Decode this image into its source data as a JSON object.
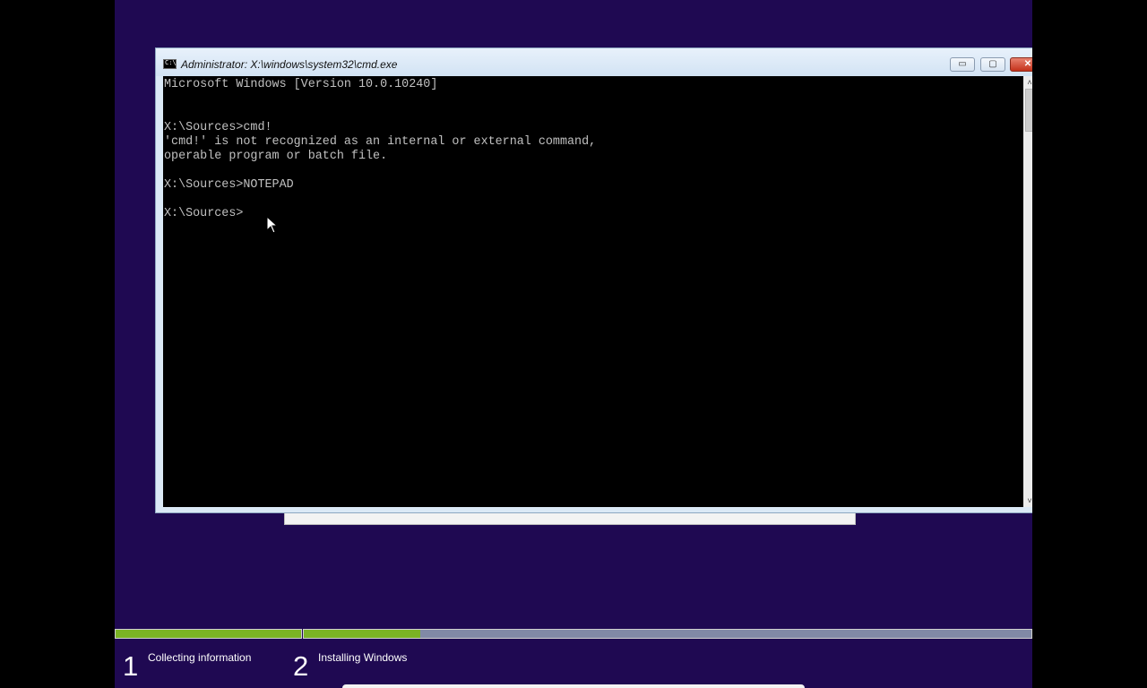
{
  "window": {
    "title": "Administrator: X:\\windows\\system32\\cmd.exe",
    "icon": "console-icon",
    "icon_glyph": "C:\\",
    "minimize_glyph": "▭",
    "maximize_glyph": "▢",
    "close_glyph": "✕"
  },
  "console": {
    "lines": [
      "Microsoft Windows [Version 10.0.10240]",
      "",
      "",
      "X:\\Sources>cmd!",
      "'cmd!' is not recognized as an internal or external command,",
      "operable program or batch file.",
      "",
      "X:\\Sources>NOTEPAD",
      "",
      "X:\\Sources>"
    ]
  },
  "scrollbar": {
    "up_glyph": "˄",
    "down_glyph": "˅"
  },
  "setup": {
    "steps": [
      {
        "number": "1",
        "label": "Collecting information",
        "progress": 1.0
      },
      {
        "number": "2",
        "label": "Installing Windows",
        "progress": 0.16
      }
    ]
  },
  "colors": {
    "background": "#1f0952",
    "progress_fill": "#7ab324",
    "progress_track": "#8189a6"
  }
}
